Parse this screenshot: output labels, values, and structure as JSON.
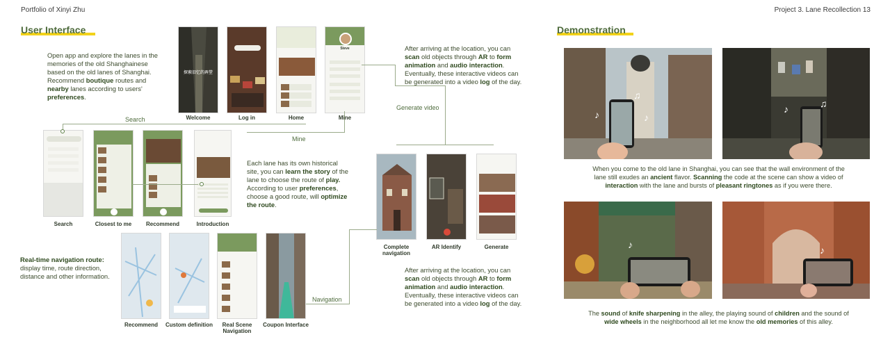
{
  "header": {
    "left": "Portfolio of Xinyi Zhu",
    "right": "Project 3.  Lane Recollection 13"
  },
  "ui": {
    "title": "User Interface",
    "intro": {
      "t1": "Open app and explore the lanes in the memories of the old Shanghainese based on the old lanes of Shanghai. Recommend ",
      "b1": "boutique",
      "t2": " routes and ",
      "b2": "nearby",
      "t3": " lanes according to users' ",
      "b3": "preferences",
      "t4": "."
    },
    "screens_top": [
      "Welcome",
      "Log in",
      "Home",
      "Mine"
    ],
    "welcome_text": "探索旧忆的弄堂",
    "mine_name": "Steve",
    "labels": {
      "search": "Search",
      "mine": "Mine",
      "generate_video": "Generate video",
      "navigation": "Navigation"
    },
    "screens_mid": [
      "Search",
      "Closest to me",
      "Recommend",
      "Introduction"
    ],
    "lane_text": {
      "t1": "Each lane has its own historical site, you can ",
      "b1": "learn the story",
      "t2": " of the lane to choose the route of ",
      "b2": "play.",
      "t3": " According to user ",
      "b3": "preferences",
      "t4": ", choose a good route, will ",
      "b4": "optimize the route",
      "t5": "."
    },
    "ar_text": {
      "t1": "After arriving at the location, you can ",
      "b1": "scan",
      "t2": " old objects through ",
      "b2": "AR",
      "t3": " to ",
      "b3": "form animation",
      "t4": " and ",
      "b4": "audio interaction",
      "t5": ". Eventually, these interactive videos can be generated into a video ",
      "b5": "log",
      "t6": " of the day."
    },
    "screens_ar": [
      "Complete navigation",
      "AR Identify",
      "Generate"
    ],
    "nav_text": {
      "b1": "Real-time navigation route:",
      "t1": " display time, route direction, distance and other information."
    },
    "screens_bottom": [
      "Recommend",
      "Custom definition",
      "Real Scene Navigation",
      "Coupon Interface"
    ]
  },
  "demo": {
    "title": "Demonstration",
    "cap1": {
      "t1": "When you come to the old lane in Shanghai, you can see that the wall environment of the lane still exudes an ",
      "b1": "ancient",
      "t2": " flavor. ",
      "b2": "Scanning",
      "t3": " the code at the scene can show a video of ",
      "b3": "interaction",
      "t4": " with the lane and bursts of ",
      "b4": "pleasant ringtones",
      "t5": " as if you were there."
    },
    "cap2": {
      "t1": "The ",
      "b1": "sound",
      "t2": " of ",
      "b2": "knife sharpening",
      "t3": " in the alley, the playing sound of ",
      "b3": "children",
      "t4": " and the sound of ",
      "b4": "wide wheels",
      "t5": " in the neighborhood all let me know the ",
      "b5": "old memories",
      "t6": " of this alley."
    }
  },
  "colors": {
    "accent_green": "#4e6b3c",
    "highlight_yellow": "#f2d21a",
    "app_green": "#7b9a5e"
  }
}
